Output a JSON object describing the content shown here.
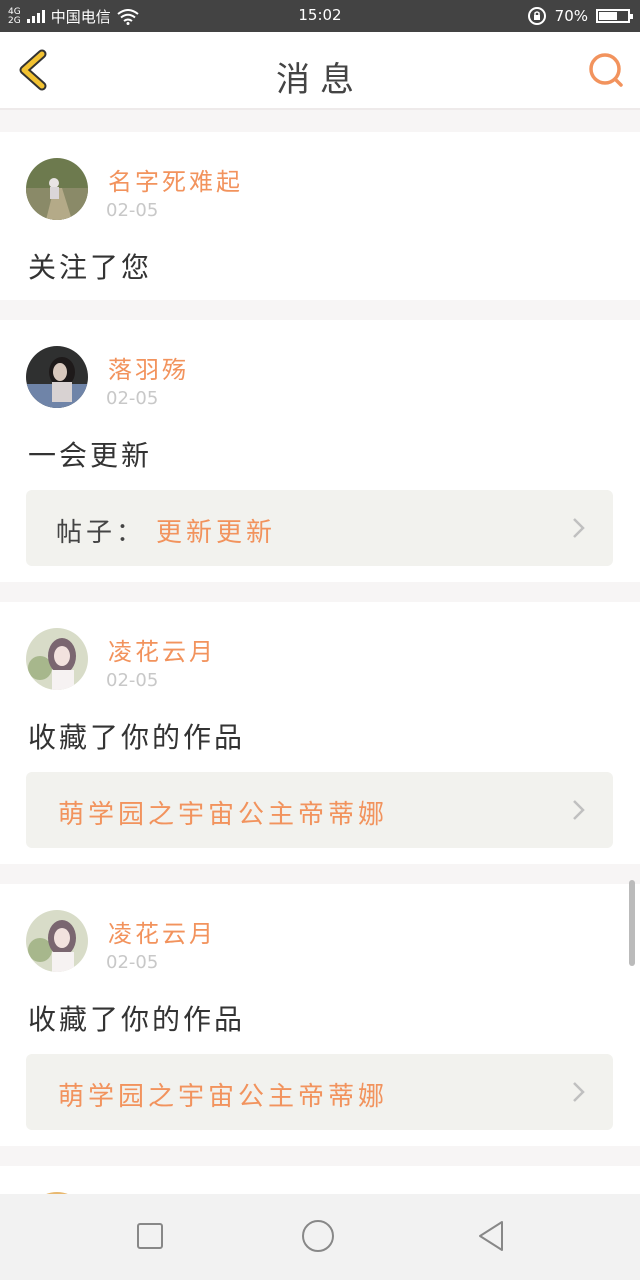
{
  "status_bar": {
    "network_top": "4G",
    "network_bottom": "2G",
    "carrier": "中国电信",
    "time": "15:02",
    "battery": "70%",
    "battery_level": 0.7
  },
  "header": {
    "title": "消息",
    "icons": {
      "back": "back-chevron-icon",
      "search": "search-icon"
    }
  },
  "notifications": [
    {
      "name": "名字死难起",
      "date": "02-05",
      "text": "关注了您"
    },
    {
      "name": "落羽殇",
      "date": "02-05",
      "text": "一会更新",
      "ref_label": "帖子：",
      "ref_text": "更新更新"
    },
    {
      "name": "凌花云月",
      "date": "02-05",
      "text": "收藏了你的作品",
      "ref_text": "萌学园之宇宙公主帝蒂娜"
    },
    {
      "name": "凌花云月",
      "date": "02-05",
      "text": "收藏了你的作品",
      "ref_text": "萌学园之宇宙公主帝蒂娜"
    }
  ],
  "colors": {
    "accent": "#f2935d",
    "back_icon": "#f2c232"
  },
  "nav_bar": {
    "icons": [
      "recents-square-icon",
      "home-circle-icon",
      "back-triangle-icon"
    ]
  }
}
